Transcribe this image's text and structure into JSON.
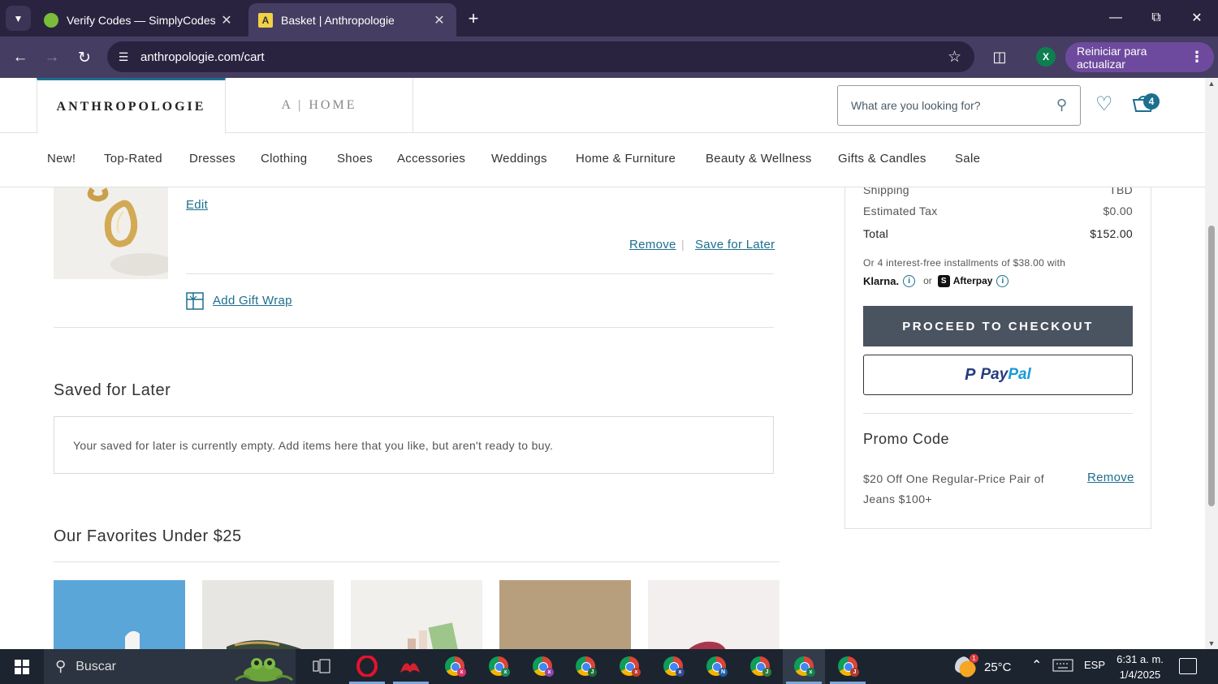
{
  "browser": {
    "tabs": [
      {
        "title": "Verify Codes — SimplyCodes",
        "active": false
      },
      {
        "title": "Basket | Anthropologie",
        "active": true,
        "favicon_letter": "A"
      }
    ],
    "url": "anthropologie.com/cart",
    "profile_initial": "X",
    "relaunch_label": "Reiniciar para actualizar"
  },
  "site": {
    "brand": "ANTHROPOLOGIE",
    "home_brand": "A | HOME",
    "search_placeholder": "What are you looking for?",
    "basket_count": "4",
    "colors": {
      "accent": "#1d6f8e",
      "checkout": "#4a5360"
    },
    "nav": [
      "New!",
      "Top-Rated",
      "Dresses",
      "Clothing",
      "Shoes",
      "Accessories",
      "Weddings",
      "Home & Furniture",
      "Beauty & Wellness",
      "Gifts & Candles",
      "Sale"
    ]
  },
  "cart_item": {
    "edit_label": "Edit",
    "remove_label": "Remove",
    "separator": "|",
    "save_later_label": "Save for Later",
    "gift_wrap_label": "Add Gift Wrap"
  },
  "saved_for_later": {
    "title": "Saved for Later",
    "empty_message": "Your saved for later is currently empty. Add items here that you like, but aren't ready to buy."
  },
  "favorites": {
    "title": "Our Favorites Under $25"
  },
  "summary": {
    "shipping_label": "Shipping",
    "shipping_value": "TBD",
    "tax_label": "Estimated Tax",
    "tax_value": "$0.00",
    "total_label": "Total",
    "total_value": "$152.00",
    "installments_text": "Or 4 interest-free installments of $38.00 with",
    "klarna_label": "Klarna.",
    "or_label": "or",
    "afterpay_label": "Afterpay",
    "checkout_label": "PROCEED TO CHECKOUT",
    "paypal_pay": "Pay",
    "paypal_pal": "Pal",
    "promo_title": "Promo Code",
    "promo_desc": "$20 Off One Regular-Price Pair of Jeans $100+",
    "promo_remove_label": "Remove"
  },
  "taskbar": {
    "search_label": "Buscar",
    "temperature": "25°C",
    "language": "ESP",
    "time": "6:31 a. m.",
    "date": "1/4/2025"
  }
}
